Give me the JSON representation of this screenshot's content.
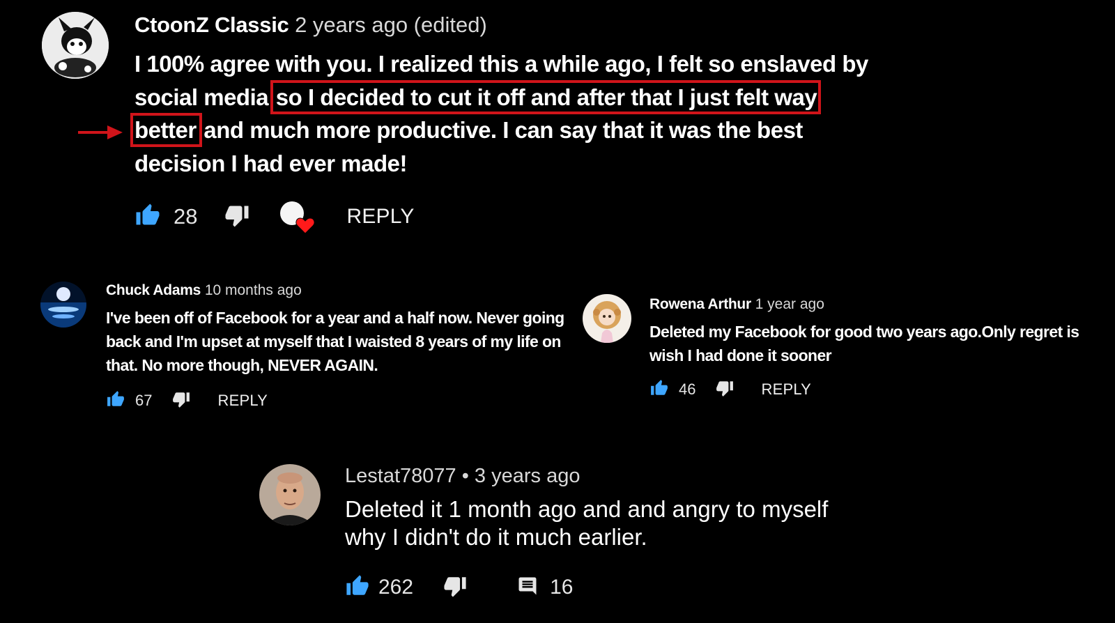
{
  "comments": [
    {
      "author": "CtoonZ Classic",
      "meta": "2 years ago (edited)",
      "body_before": "I 100% agree with you. I realized this a while ago, I felt so enslaved by social media ",
      "body_highlight": "so I decided to cut it off and after that I just felt way better",
      "body_after": " and much more productive. I can say that it was the best decision I had ever made!",
      "likes": "28",
      "reply": "REPLY"
    },
    {
      "author": "Chuck Adams",
      "meta": "10 months ago",
      "body": "I've been off of Facebook for a year and a half now. Never going back and I'm upset at myself that I waisted 8 years of my life on that. No more though, NEVER AGAIN.",
      "likes": "67",
      "reply": "REPLY"
    },
    {
      "author": "Rowena Arthur",
      "meta": "1 year ago",
      "body": "Deleted my Facebook for good two years ago.Only regret is wish I had done it sooner",
      "likes": "46",
      "reply": "REPLY"
    },
    {
      "author": "Lestat78077",
      "meta": "• 3 years ago",
      "body": "Deleted it 1 month ago and and angry to myself why I didn't do it much earlier.",
      "likes": "262",
      "replies": "16"
    }
  ],
  "colors": {
    "background": "#000000",
    "like_blue": "#3ea6ff",
    "highlight_red": "#d0141a",
    "heart_red": "#ff0000"
  },
  "icons": [
    "thumbs-up-icon",
    "thumbs-down-icon",
    "creator-heart-icon",
    "comment-icon",
    "arrow-icon"
  ]
}
